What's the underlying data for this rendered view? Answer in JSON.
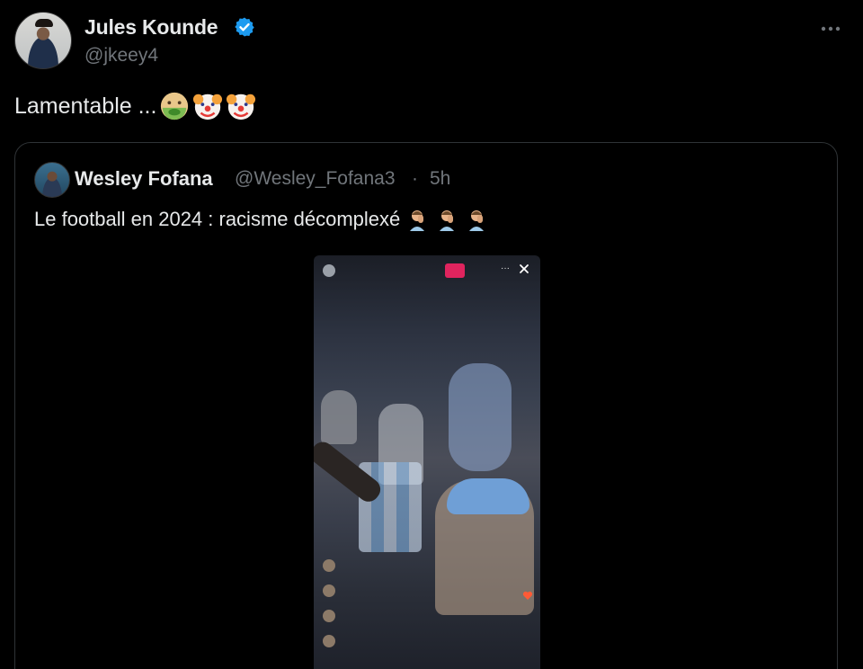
{
  "post": {
    "author_name": "Jules Kounde",
    "handle": "@jkeey4",
    "text": "Lamentable ...",
    "emojis": [
      "nauseated-face-emoji",
      "clown-face-emoji",
      "clown-face-emoji"
    ],
    "more_icon": "more-horizontal-icon"
  },
  "quote": {
    "author_name": "Wesley Fofana",
    "handle": "@Wesley_Fofana3",
    "separator": "·",
    "time": "5h",
    "text": "Le football en 2024 : racisme décomplexé",
    "emojis": [
      "man-facepalming-emoji",
      "man-facepalming-emoji",
      "man-facepalming-emoji"
    ]
  },
  "colors": {
    "background": "#000000",
    "text_primary": "#e7e9ea",
    "text_secondary": "#71767b",
    "verified": "#1d9bf0",
    "border": "#2f3336",
    "live_badge": "#e0245e"
  }
}
